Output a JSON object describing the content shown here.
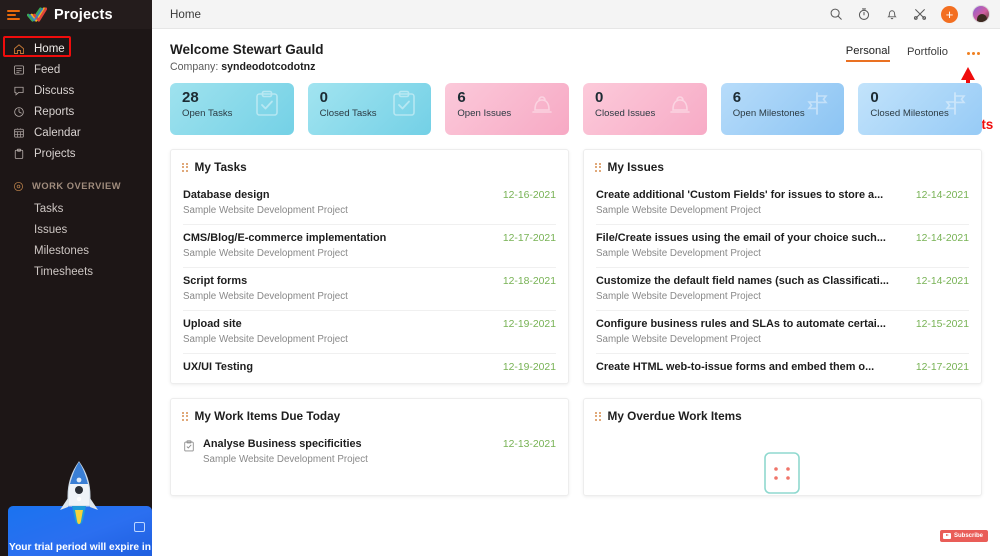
{
  "sidebar": {
    "brand": "Projects",
    "nav": [
      {
        "label": "Home",
        "icon": "home-icon",
        "active": true
      },
      {
        "label": "Feed",
        "icon": "feed-icon",
        "active": false
      },
      {
        "label": "Discuss",
        "icon": "discuss-icon",
        "active": false
      },
      {
        "label": "Reports",
        "icon": "reports-icon",
        "active": false
      },
      {
        "label": "Calendar",
        "icon": "calendar-icon",
        "active": false
      },
      {
        "label": "Projects",
        "icon": "projects-icon",
        "active": false
      }
    ],
    "section_label": "WORK OVERVIEW",
    "sub_items": [
      {
        "label": "Tasks"
      },
      {
        "label": "Issues"
      },
      {
        "label": "Milestones"
      },
      {
        "label": "Timesheets"
      }
    ],
    "trial_text": "Your trial period will expire in"
  },
  "topbar": {
    "breadcrumb": "Home",
    "icons": [
      "search-icon",
      "timer-icon",
      "bell-icon",
      "shortcut-icon"
    ],
    "plus_label": "+"
  },
  "welcome": {
    "greeting": "Welcome Stewart Gauld",
    "company_label": "Company: ",
    "company_name": "syndeodotcodotnz",
    "tabs": [
      {
        "label": "Personal",
        "active": true
      },
      {
        "label": "Portfolio",
        "active": false
      }
    ],
    "annotation": "Three Dots"
  },
  "colors": {
    "accent": "#f36f21",
    "annotation_red": "#ef0c0c",
    "date_green": "#77b254",
    "cyan_card": "#8fdceb",
    "pink_card": "#f9b9cd",
    "blue_card": "#a9d4f5"
  },
  "stats": [
    {
      "value": "28",
      "label": "Open Tasks",
      "icon": "clipboard-check-icon",
      "bg": "#8ddcea",
      "bg2": "#a6e4ef"
    },
    {
      "value": "0",
      "label": "Closed Tasks",
      "icon": "clipboard-check-icon",
      "bg": "#8cdbea",
      "bg2": "#a8e5f0"
    },
    {
      "value": "6",
      "label": "Open Issues",
      "icon": "bug-icon",
      "bg": "#f8b9ce",
      "bg2": "#fcd2e0"
    },
    {
      "value": "0",
      "label": "Closed Issues",
      "icon": "bug-icon",
      "bg": "#f9bad0",
      "bg2": "#fcd4e1"
    },
    {
      "value": "6",
      "label": "Open Milestones",
      "icon": "milestone-flag-icon",
      "bg": "#9ccef6",
      "bg2": "#bcdffa"
    },
    {
      "value": "0",
      "label": "Closed Milestones",
      "icon": "milestone-flag-icon",
      "bg": "#a8d6f8",
      "bg2": "#c6e4fb"
    }
  ],
  "panels": {
    "my_tasks": {
      "title": "My Tasks",
      "items": [
        {
          "name": "Database design",
          "project": "Sample Website Development Project",
          "date": "12-16-2021"
        },
        {
          "name": "CMS/Blog/E-commerce implementation",
          "project": "Sample Website Development Project",
          "date": "12-17-2021"
        },
        {
          "name": "Script forms",
          "project": "Sample Website Development Project",
          "date": "12-18-2021"
        },
        {
          "name": "Upload site",
          "project": "Sample Website Development Project",
          "date": "12-19-2021"
        },
        {
          "name": "UX/UI Testing",
          "project": "",
          "date": "12-19-2021"
        }
      ]
    },
    "my_issues": {
      "title": "My Issues",
      "items": [
        {
          "name": "Create additional 'Custom Fields' for issues to store a...",
          "project": "Sample Website Development Project",
          "date": "12-14-2021"
        },
        {
          "name": "File/Create issues using the email of your choice such...",
          "project": "Sample Website Development Project",
          "date": "12-14-2021"
        },
        {
          "name": "Customize the default field names (such as Classificati...",
          "project": "Sample Website Development Project",
          "date": "12-14-2021"
        },
        {
          "name": "Configure business rules and SLAs to automate certai...",
          "project": "Sample Website Development Project",
          "date": "12-15-2021"
        },
        {
          "name": "Create HTML web-to-issue forms and embed them o...",
          "project": "",
          "date": "12-17-2021"
        }
      ]
    },
    "due_today": {
      "title": "My Work Items Due Today",
      "items": [
        {
          "name": "Analyse Business specificities",
          "project": "Sample Website Development Project",
          "date": "12-13-2021"
        }
      ]
    },
    "overdue": {
      "title": "My Overdue Work Items",
      "items": []
    }
  },
  "overlay": {
    "subscribe_label": "Subscribe"
  }
}
